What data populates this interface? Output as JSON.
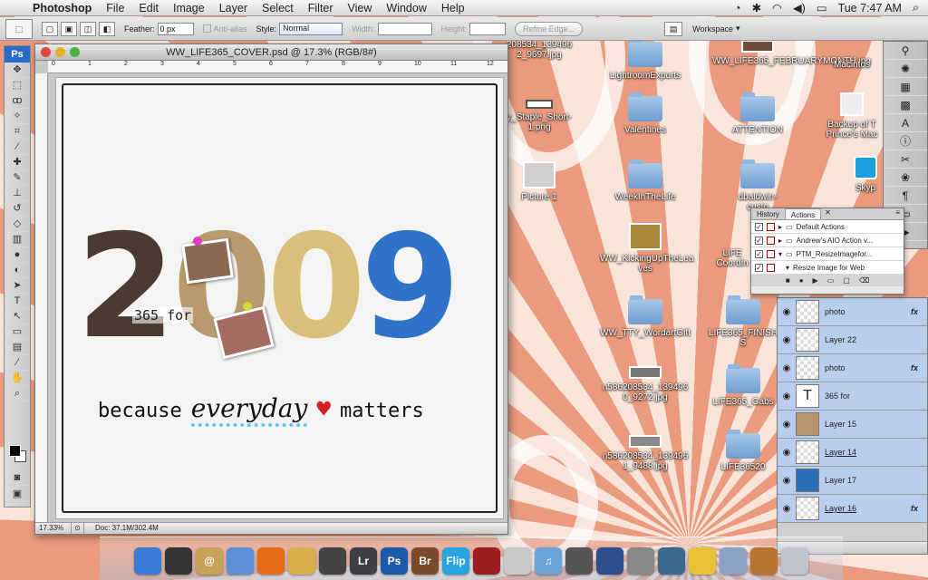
{
  "menubar": {
    "apple": "",
    "app": "Photoshop",
    "items": [
      "File",
      "Edit",
      "Image",
      "Layer",
      "Select",
      "Filter",
      "View",
      "Window",
      "Help"
    ],
    "clock": "Tue 7:47 AM"
  },
  "options": {
    "feather_label": "Feather:",
    "feather_value": "0 px",
    "antialias": "Anti-alias",
    "style_label": "Style:",
    "style_value": "Normal",
    "width_label": "Width:",
    "height_label": "Height:",
    "refine_edge": "Refine Edge...",
    "workspace": "Workspace"
  },
  "toolbox": {
    "ps_label": "Ps"
  },
  "document": {
    "title": "WW_LIFE365_COVER.psd @ 17.3% (RGB/8#)",
    "zoom": "17.33%",
    "doc_size": "Doc: 37.1M/302.4M",
    "ruler_ticks": [
      "0",
      "1",
      "2",
      "3",
      "4",
      "5",
      "6",
      "7",
      "8",
      "9",
      "10",
      "11",
      "12"
    ],
    "art": {
      "digits": [
        "2",
        "0",
        "0",
        "9"
      ],
      "subtitle": "365 for",
      "because": "because",
      "everyday": "everyday",
      "heart": "♥",
      "matters": "matters"
    }
  },
  "desktop_icons": [
    {
      "label": "208534_139496\n2_9697.jpg",
      "kind": "thumb"
    },
    {
      "label": "LightroomExports",
      "kind": "folder"
    },
    {
      "label": "WW_LIFE365_FEBRUARYMONTH.jpg",
      "kind": "thumb"
    },
    {
      "label": "Macintos",
      "kind": "drive"
    },
    {
      "label": "y_Staple_Short-\n1.png",
      "kind": "thumb"
    },
    {
      "label": "Valentines",
      "kind": "folder"
    },
    {
      "label": "ATTENTION",
      "kind": "folder"
    },
    {
      "label": "Backup of T\nPrince's Mac",
      "kind": "drive"
    },
    {
      "label": "Picture 1",
      "kind": "thumb"
    },
    {
      "label": "WeekInTheLife",
      "kind": "folder"
    },
    {
      "label": "dbaldwin-\ncusto",
      "kind": "folder"
    },
    {
      "label": "Skyp",
      "kind": "app"
    },
    {
      "label": "WW_KickingUpTheLea\nves",
      "kind": "thumb"
    },
    {
      "label": "LIFE\nCoordin",
      "kind": "thumb"
    },
    {
      "label": "WW_TTY_WordartGift",
      "kind": "folder"
    },
    {
      "label": "LIFE365_FINISH\nS",
      "kind": "folder"
    },
    {
      "label": "n586208534_139496\n0_9272.jpg",
      "kind": "thumb"
    },
    {
      "label": "LIFE365_Gabs",
      "kind": "folder"
    },
    {
      "label": "n586208534_139496\n1_9488.jpg",
      "kind": "thumb"
    },
    {
      "label": "LIFE36520",
      "kind": "folder"
    }
  ],
  "actions_panel": {
    "tabs": [
      "History",
      "Actions"
    ],
    "rows": [
      "Default Actions",
      "Andrew's AIO Action v...",
      "PTM_ResizeImagefor...",
      "Resize Image for Web"
    ]
  },
  "layers": [
    {
      "name": "photo",
      "fx": "fx"
    },
    {
      "name": "Layer 22",
      "fx": ""
    },
    {
      "name": "photo",
      "fx": "fx"
    },
    {
      "name": "365 for",
      "fx": "",
      "type": "T"
    },
    {
      "name": "Layer 15",
      "fx": ""
    },
    {
      "name": "Layer 14",
      "fx": ""
    },
    {
      "name": "Layer 17",
      "fx": ""
    },
    {
      "name": "Layer 16",
      "fx": "fx"
    }
  ],
  "dock_apps": [
    {
      "label": "Finder",
      "short": "",
      "color": "#3a7bd5"
    },
    {
      "label": "Dashboard",
      "short": "",
      "color": "#333333"
    },
    {
      "label": "Address Book",
      "short": "@",
      "color": "#c8a25a"
    },
    {
      "label": "Mail",
      "short": "",
      "color": "#5d8fd8"
    },
    {
      "label": "Firefox",
      "short": "",
      "color": "#e66b1b"
    },
    {
      "label": "Script Editor",
      "short": "",
      "color": "#d7b04a"
    },
    {
      "label": "iPhoto",
      "short": "",
      "color": "#444444"
    },
    {
      "label": "Lightroom",
      "short": "Lr",
      "color": "#3d3f44"
    },
    {
      "label": "Photoshop",
      "short": "Ps",
      "color": "#1c5aa9"
    },
    {
      "label": "Bridge",
      "short": "Br",
      "color": "#7b4a2a"
    },
    {
      "label": "Flip Video",
      "short": "Flip",
      "color": "#29a4e0"
    },
    {
      "label": "Photo Booth",
      "short": "",
      "color": "#9b1d1d"
    },
    {
      "label": "Preview",
      "short": "",
      "color": "#c9c9c9"
    },
    {
      "label": "iTunes",
      "short": "♫",
      "color": "#6aa4d8"
    },
    {
      "label": "iMovie",
      "short": "",
      "color": "#555555"
    },
    {
      "label": "Spaces",
      "short": "",
      "color": "#2d4f8b"
    },
    {
      "label": "Scanner",
      "short": "",
      "color": "#888888"
    },
    {
      "label": "Time Machine",
      "short": "",
      "color": "#3c6a8d"
    },
    {
      "label": "Cyberduck",
      "short": "",
      "color": "#e9c23a"
    },
    {
      "label": "Disk Utility",
      "short": "",
      "color": "#8aa2c6"
    },
    {
      "label": "Keynote",
      "short": "",
      "color": "#b8752f"
    },
    {
      "label": "Trash",
      "short": "",
      "color": "#bfc4cc"
    }
  ]
}
